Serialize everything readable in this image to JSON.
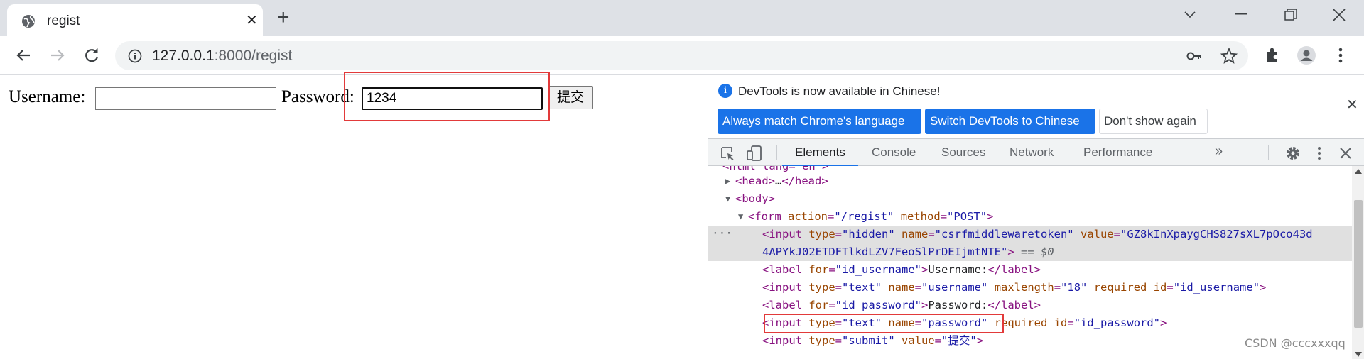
{
  "browser": {
    "tab_title": "regist",
    "url_host": "127.0.0.1",
    "url_rest": ":8000/regist"
  },
  "page": {
    "username_label": "Username:",
    "username_value": "",
    "password_label": "Password:",
    "password_value": "1234",
    "submit_label": "提交"
  },
  "devtools": {
    "banner_message": "DevTools is now available in Chinese!",
    "btn_match": "Always match Chrome's language",
    "btn_switch": "Switch DevTools to Chinese",
    "btn_dismiss": "Don't show again",
    "tabs": [
      "Elements",
      "Console",
      "Sources",
      "Network",
      "Performance"
    ],
    "active_tab": "Elements",
    "dom": {
      "l0": "<html lang=\"en\">",
      "l1_tag": "<head>",
      "l1_ell": "…",
      "l1_close": "</head>",
      "l2": "<body>",
      "l3_tag": "<form ",
      "l3_a1": "action",
      "l3_v1": "\"/regist\"",
      "l3_a2": "method",
      "l3_v2": "\"POST\"",
      "l4_a1": "type",
      "l4_v1": "\"hidden\"",
      "l4_a2": "name",
      "l4_v2": "\"csrfmiddlewaretoken\"",
      "l4_a3": "value",
      "l4_v3a": "\"GZ8kInXpaygCHS827sXL7pOco43d",
      "l4_v3b": "4APYkJ02ETDFTlkdLZV7FeoSlPrDEIjmtNTE\"",
      "l4_eq": " == $0",
      "l5_a": "for",
      "l5_v": "\"id_username\"",
      "l5_t": "Username:",
      "l6_a1": "type",
      "l6_v1": "\"text\"",
      "l6_a2": "name",
      "l6_v2": "\"username\"",
      "l6_a3": "maxlength",
      "l6_v3": "\"18\"",
      "l6_a4": "required",
      "l6_a5": "id",
      "l6_v5": "\"id_username\"",
      "l7_a": "for",
      "l7_v": "\"id_password\"",
      "l7_t": "Password:",
      "l8_a1": "type",
      "l8_v1": "\"text\"",
      "l8_a2": "name",
      "l8_v2": "\"password\"",
      "l8_a3": "required",
      "l8_a4": "id",
      "l8_v4": "\"id_password\"",
      "l9_a1": "type",
      "l9_v1": "\"submit\"",
      "l9_a2": "value",
      "l9_v2": "\"提交\""
    }
  },
  "watermark": "CSDN @cccxxxqq",
  "colors": {
    "highlight_box": "#e23a3a",
    "devtools_blue": "#1a73e8"
  }
}
